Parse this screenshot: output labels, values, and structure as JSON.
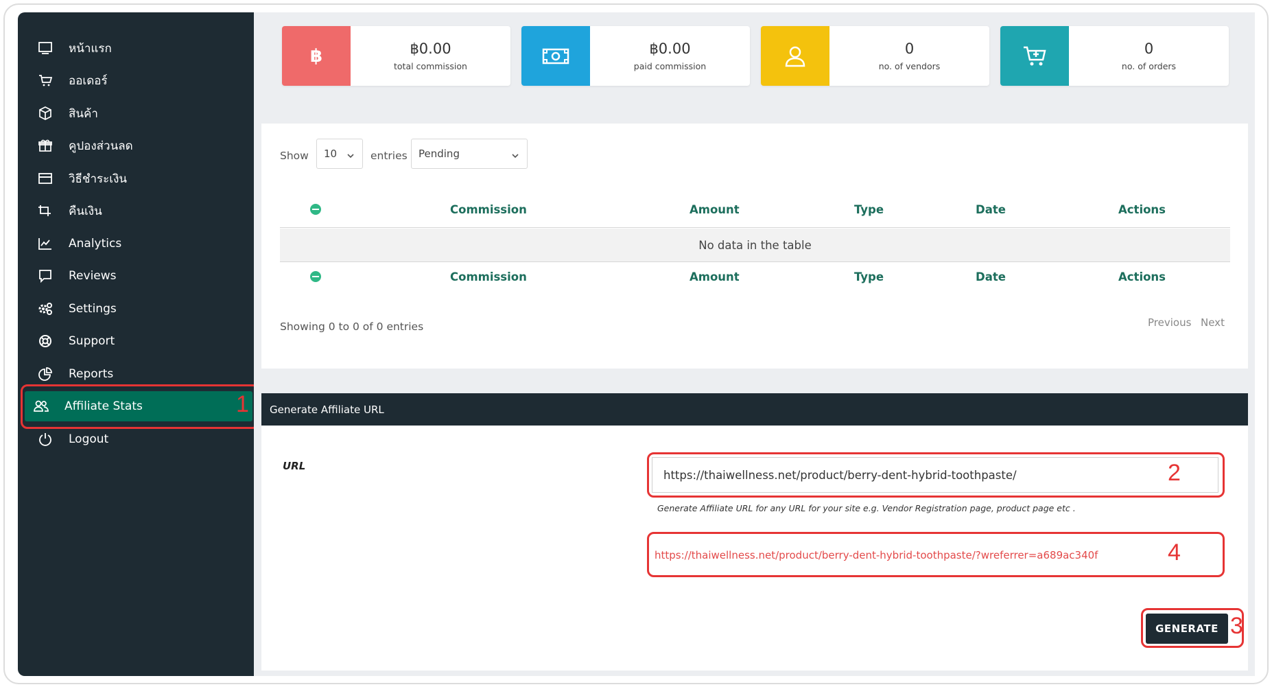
{
  "sidebar": {
    "items": [
      {
        "label": "หน้าแรก",
        "icon": "monitor-icon"
      },
      {
        "label": "ออเดอร์",
        "icon": "cart-icon"
      },
      {
        "label": "สินค้า",
        "icon": "box-icon"
      },
      {
        "label": "คูปองส่วนลด",
        "icon": "gift-icon"
      },
      {
        "label": "วิธีชำระเงิน",
        "icon": "credit-card-icon"
      },
      {
        "label": "คืนเงิน",
        "icon": "refund-icon"
      },
      {
        "label": "Analytics",
        "icon": "chart-icon"
      },
      {
        "label": "Reviews",
        "icon": "comment-icon"
      },
      {
        "label": "Settings",
        "icon": "gears-icon"
      },
      {
        "label": "Support",
        "icon": "lifebuoy-icon"
      },
      {
        "label": "Reports",
        "icon": "pie-icon"
      },
      {
        "label": "Affiliate Stats",
        "icon": "users-icon",
        "active": true
      },
      {
        "label": "Logout",
        "icon": "power-icon"
      }
    ]
  },
  "stats": [
    {
      "value": "฿0.00",
      "label": "total commission",
      "color": "#ef6a6a",
      "icon": "baht-icon"
    },
    {
      "value": "฿0.00",
      "label": "paid commission",
      "color": "#1fa4dc",
      "icon": "money-icon"
    },
    {
      "value": "0",
      "label": "no. of vendors",
      "color": "#f4c20d",
      "icon": "user-icon"
    },
    {
      "value": "0",
      "label": "no. of orders",
      "color": "#1fa6b0",
      "icon": "cart-add-icon"
    }
  ],
  "table": {
    "show_label": "Show",
    "entries_value": "10",
    "entries_label": "entries",
    "status_filter": "Pending",
    "columns": [
      "Commission",
      "Amount",
      "Type",
      "Date",
      "Actions"
    ],
    "empty_message": "No data in the table",
    "info": "Showing 0 to 0 of 0 entries",
    "prev": "Previous",
    "next": "Next"
  },
  "affiliate": {
    "title": "Generate Affiliate URL",
    "url_label": "URL",
    "url_value": "https://thaiwellness.net/product/berry-dent-hybrid-toothpaste/",
    "hint": "Generate Affiliate URL for any URL for your site e.g. Vendor Registration page, product page etc .",
    "result": "https://thaiwellness.net/product/berry-dent-hybrid-toothpaste/?wreferrer=a689ac340f",
    "generate": "GENERATE"
  },
  "annotations": [
    "1",
    "2",
    "3",
    "4"
  ],
  "colors": {
    "sidebar": "#1e2b33",
    "active": "#006e57",
    "highlight": "#e63434",
    "header_text": "#1c6e5c"
  }
}
